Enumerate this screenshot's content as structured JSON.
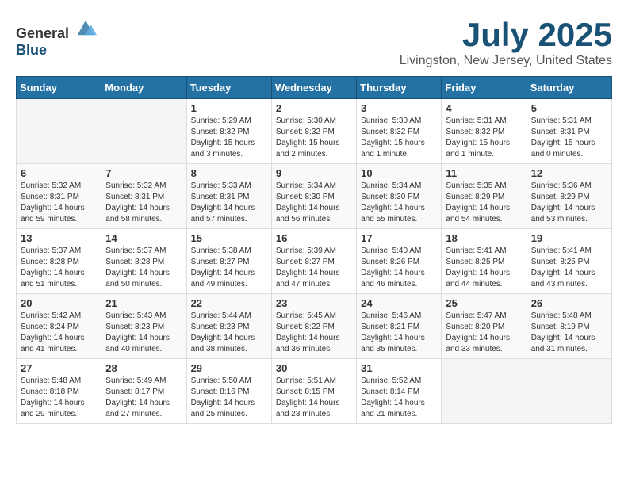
{
  "logo": {
    "text_general": "General",
    "text_blue": "Blue"
  },
  "title": {
    "month_year": "July 2025",
    "location": "Livingston, New Jersey, United States"
  },
  "weekdays": [
    "Sunday",
    "Monday",
    "Tuesday",
    "Wednesday",
    "Thursday",
    "Friday",
    "Saturday"
  ],
  "weeks": [
    [
      {
        "day": "",
        "sunrise": "",
        "sunset": "",
        "daylight": ""
      },
      {
        "day": "",
        "sunrise": "",
        "sunset": "",
        "daylight": ""
      },
      {
        "day": "1",
        "sunrise": "Sunrise: 5:29 AM",
        "sunset": "Sunset: 8:32 PM",
        "daylight": "Daylight: 15 hours and 3 minutes."
      },
      {
        "day": "2",
        "sunrise": "Sunrise: 5:30 AM",
        "sunset": "Sunset: 8:32 PM",
        "daylight": "Daylight: 15 hours and 2 minutes."
      },
      {
        "day": "3",
        "sunrise": "Sunrise: 5:30 AM",
        "sunset": "Sunset: 8:32 PM",
        "daylight": "Daylight: 15 hours and 1 minute."
      },
      {
        "day": "4",
        "sunrise": "Sunrise: 5:31 AM",
        "sunset": "Sunset: 8:32 PM",
        "daylight": "Daylight: 15 hours and 1 minute."
      },
      {
        "day": "5",
        "sunrise": "Sunrise: 5:31 AM",
        "sunset": "Sunset: 8:31 PM",
        "daylight": "Daylight: 15 hours and 0 minutes."
      }
    ],
    [
      {
        "day": "6",
        "sunrise": "Sunrise: 5:32 AM",
        "sunset": "Sunset: 8:31 PM",
        "daylight": "Daylight: 14 hours and 59 minutes."
      },
      {
        "day": "7",
        "sunrise": "Sunrise: 5:32 AM",
        "sunset": "Sunset: 8:31 PM",
        "daylight": "Daylight: 14 hours and 58 minutes."
      },
      {
        "day": "8",
        "sunrise": "Sunrise: 5:33 AM",
        "sunset": "Sunset: 8:31 PM",
        "daylight": "Daylight: 14 hours and 57 minutes."
      },
      {
        "day": "9",
        "sunrise": "Sunrise: 5:34 AM",
        "sunset": "Sunset: 8:30 PM",
        "daylight": "Daylight: 14 hours and 56 minutes."
      },
      {
        "day": "10",
        "sunrise": "Sunrise: 5:34 AM",
        "sunset": "Sunset: 8:30 PM",
        "daylight": "Daylight: 14 hours and 55 minutes."
      },
      {
        "day": "11",
        "sunrise": "Sunrise: 5:35 AM",
        "sunset": "Sunset: 8:29 PM",
        "daylight": "Daylight: 14 hours and 54 minutes."
      },
      {
        "day": "12",
        "sunrise": "Sunrise: 5:36 AM",
        "sunset": "Sunset: 8:29 PM",
        "daylight": "Daylight: 14 hours and 53 minutes."
      }
    ],
    [
      {
        "day": "13",
        "sunrise": "Sunrise: 5:37 AM",
        "sunset": "Sunset: 8:28 PM",
        "daylight": "Daylight: 14 hours and 51 minutes."
      },
      {
        "day": "14",
        "sunrise": "Sunrise: 5:37 AM",
        "sunset": "Sunset: 8:28 PM",
        "daylight": "Daylight: 14 hours and 50 minutes."
      },
      {
        "day": "15",
        "sunrise": "Sunrise: 5:38 AM",
        "sunset": "Sunset: 8:27 PM",
        "daylight": "Daylight: 14 hours and 49 minutes."
      },
      {
        "day": "16",
        "sunrise": "Sunrise: 5:39 AM",
        "sunset": "Sunset: 8:27 PM",
        "daylight": "Daylight: 14 hours and 47 minutes."
      },
      {
        "day": "17",
        "sunrise": "Sunrise: 5:40 AM",
        "sunset": "Sunset: 8:26 PM",
        "daylight": "Daylight: 14 hours and 46 minutes."
      },
      {
        "day": "18",
        "sunrise": "Sunrise: 5:41 AM",
        "sunset": "Sunset: 8:25 PM",
        "daylight": "Daylight: 14 hours and 44 minutes."
      },
      {
        "day": "19",
        "sunrise": "Sunrise: 5:41 AM",
        "sunset": "Sunset: 8:25 PM",
        "daylight": "Daylight: 14 hours and 43 minutes."
      }
    ],
    [
      {
        "day": "20",
        "sunrise": "Sunrise: 5:42 AM",
        "sunset": "Sunset: 8:24 PM",
        "daylight": "Daylight: 14 hours and 41 minutes."
      },
      {
        "day": "21",
        "sunrise": "Sunrise: 5:43 AM",
        "sunset": "Sunset: 8:23 PM",
        "daylight": "Daylight: 14 hours and 40 minutes."
      },
      {
        "day": "22",
        "sunrise": "Sunrise: 5:44 AM",
        "sunset": "Sunset: 8:23 PM",
        "daylight": "Daylight: 14 hours and 38 minutes."
      },
      {
        "day": "23",
        "sunrise": "Sunrise: 5:45 AM",
        "sunset": "Sunset: 8:22 PM",
        "daylight": "Daylight: 14 hours and 36 minutes."
      },
      {
        "day": "24",
        "sunrise": "Sunrise: 5:46 AM",
        "sunset": "Sunset: 8:21 PM",
        "daylight": "Daylight: 14 hours and 35 minutes."
      },
      {
        "day": "25",
        "sunrise": "Sunrise: 5:47 AM",
        "sunset": "Sunset: 8:20 PM",
        "daylight": "Daylight: 14 hours and 33 minutes."
      },
      {
        "day": "26",
        "sunrise": "Sunrise: 5:48 AM",
        "sunset": "Sunset: 8:19 PM",
        "daylight": "Daylight: 14 hours and 31 minutes."
      }
    ],
    [
      {
        "day": "27",
        "sunrise": "Sunrise: 5:48 AM",
        "sunset": "Sunset: 8:18 PM",
        "daylight": "Daylight: 14 hours and 29 minutes."
      },
      {
        "day": "28",
        "sunrise": "Sunrise: 5:49 AM",
        "sunset": "Sunset: 8:17 PM",
        "daylight": "Daylight: 14 hours and 27 minutes."
      },
      {
        "day": "29",
        "sunrise": "Sunrise: 5:50 AM",
        "sunset": "Sunset: 8:16 PM",
        "daylight": "Daylight: 14 hours and 25 minutes."
      },
      {
        "day": "30",
        "sunrise": "Sunrise: 5:51 AM",
        "sunset": "Sunset: 8:15 PM",
        "daylight": "Daylight: 14 hours and 23 minutes."
      },
      {
        "day": "31",
        "sunrise": "Sunrise: 5:52 AM",
        "sunset": "Sunset: 8:14 PM",
        "daylight": "Daylight: 14 hours and 21 minutes."
      },
      {
        "day": "",
        "sunrise": "",
        "sunset": "",
        "daylight": ""
      },
      {
        "day": "",
        "sunrise": "",
        "sunset": "",
        "daylight": ""
      }
    ]
  ]
}
